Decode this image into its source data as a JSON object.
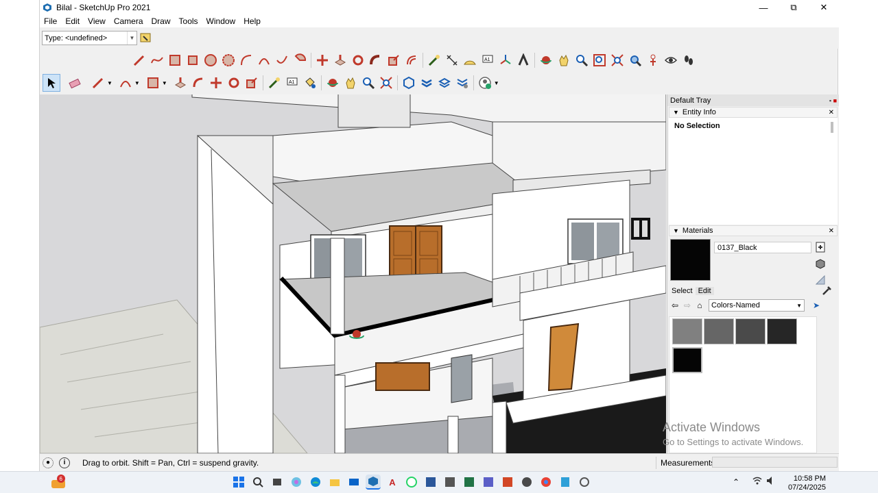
{
  "window": {
    "title": "Bilal - SketchUp Pro 2021"
  },
  "menu": [
    "File",
    "Edit",
    "View",
    "Camera",
    "Draw",
    "Tools",
    "Window",
    "Help"
  ],
  "toolbar": {
    "type_select_value": "Type: <undefined>"
  },
  "tray": {
    "title": "Default Tray",
    "entity_info": {
      "title": "Entity Info",
      "selection": "No Selection"
    },
    "materials": {
      "title": "Materials",
      "current_name": "0137_Black",
      "current_color": "#050505",
      "tab_select": "Select",
      "tab_edit": "Edit",
      "library": "Colors-Named",
      "swatches": [
        "#808080",
        "#666666",
        "#4a4a4a",
        "#262626",
        "#050505"
      ]
    }
  },
  "watermark": {
    "line1": "Activate Windows",
    "line2": "Go to Settings to activate Windows."
  },
  "status": {
    "text": "Drag to orbit. Shift = Pan, Ctrl = suspend gravity.",
    "measurements_label": "Measurements",
    "measurements_value": ""
  },
  "taskbar": {
    "notification_badge": "6",
    "time": "10:58 PM",
    "date": "07/24/2025"
  }
}
